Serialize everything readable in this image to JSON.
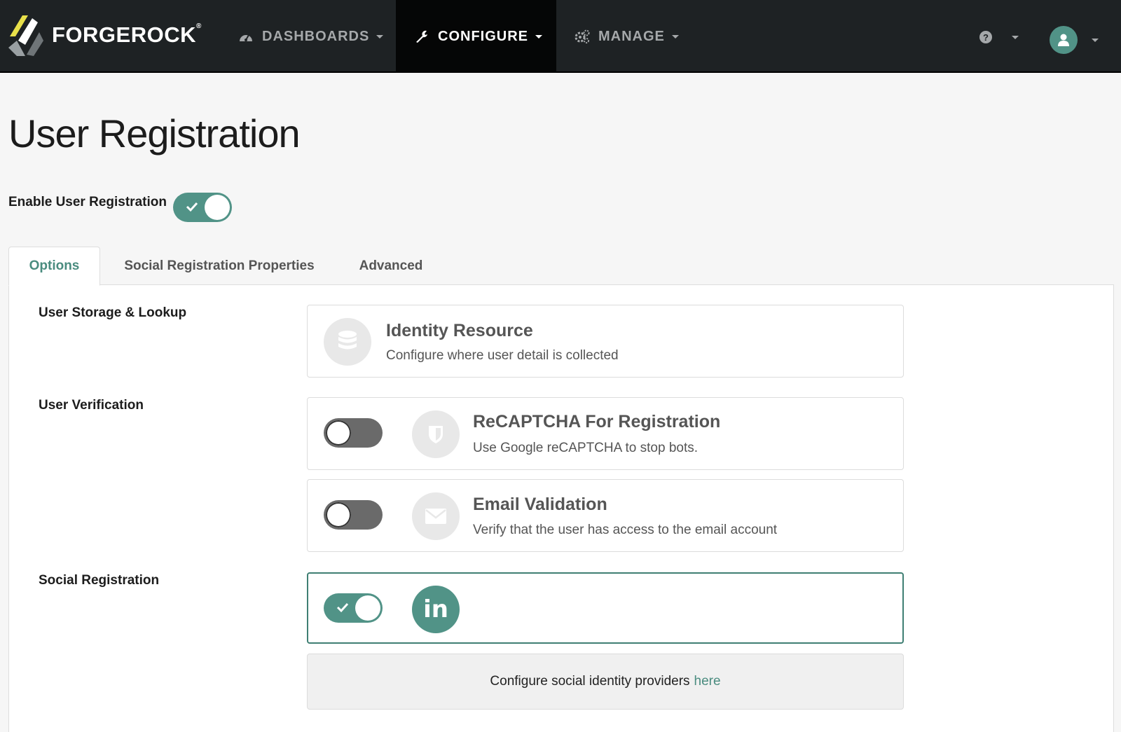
{
  "brand": {
    "name": "FORGEROCK",
    "trademark": "®"
  },
  "nav": {
    "items": [
      {
        "label": "DASHBOARDS",
        "icon": "dashboard-icon",
        "active": false
      },
      {
        "label": "CONFIGURE",
        "icon": "wrench-icon",
        "active": true
      },
      {
        "label": "MANAGE",
        "icon": "gears-icon",
        "active": false
      }
    ],
    "help_icon": "question-circle-icon",
    "user_icon": "user-avatar-icon"
  },
  "page": {
    "title": "User Registration",
    "enable_label": "Enable User Registration",
    "enable_state": true
  },
  "tabs": [
    {
      "label": "Options",
      "active": true
    },
    {
      "label": "Social Registration Properties",
      "active": false
    },
    {
      "label": "Advanced",
      "active": false
    }
  ],
  "sections": {
    "storage": {
      "label": "User Storage & Lookup",
      "card": {
        "title": "Identity Resource",
        "description": "Configure where user detail is collected",
        "icon": "database-icon"
      }
    },
    "verification": {
      "label": "User Verification",
      "cards": [
        {
          "title": "ReCAPTCHA For Registration",
          "description": "Use Google reCAPTCHA to stop bots.",
          "icon": "shield-icon",
          "enabled": false
        },
        {
          "title": "Email Validation",
          "description": "Verify that the user has access to the email account",
          "icon": "envelope-icon",
          "enabled": false
        }
      ]
    },
    "social": {
      "label": "Social Registration",
      "card": {
        "icon": "linkedin-icon",
        "icon_text": "in",
        "enabled": true
      },
      "footer_text": "Configure social identity providers",
      "footer_link": "here"
    }
  },
  "colors": {
    "accent": "#519387",
    "navbar": "#1e2224",
    "nav_active": "#050606",
    "toggle_off": "#6a6a6a"
  }
}
